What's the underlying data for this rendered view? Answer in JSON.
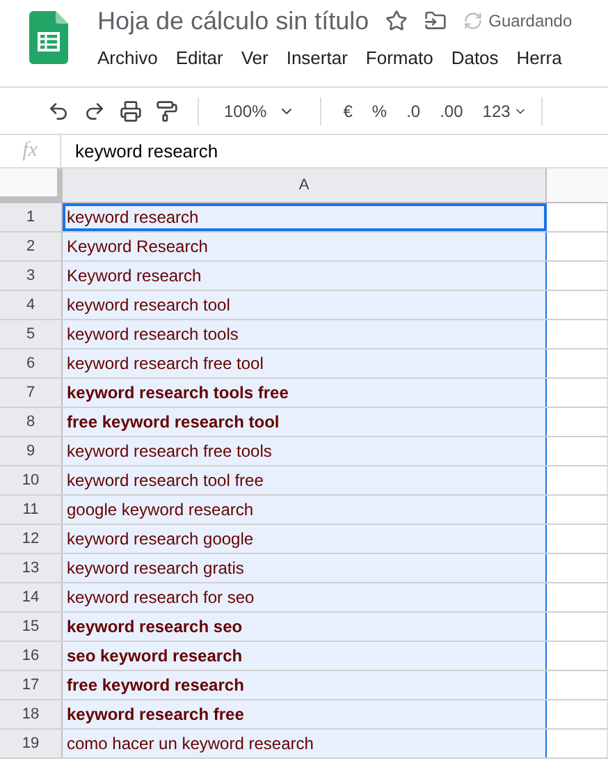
{
  "title": "Hoja de cálculo sin título",
  "save_status": "Guardando",
  "menu": [
    "Archivo",
    "Editar",
    "Ver",
    "Insertar",
    "Formato",
    "Datos",
    "Herra"
  ],
  "toolbar": {
    "zoom": "100%",
    "format_buttons": [
      "€",
      "%",
      ".0",
      ".00",
      "123"
    ]
  },
  "formula_bar": {
    "label": "fx",
    "value": "keyword research"
  },
  "column_headers": [
    "A"
  ],
  "rows": [
    {
      "number": "1",
      "text": "keyword research",
      "bold": false,
      "selected": true,
      "active": true
    },
    {
      "number": "2",
      "text": "Keyword Research",
      "bold": false,
      "selected": true,
      "active": false
    },
    {
      "number": "3",
      "text": "Keyword research",
      "bold": false,
      "selected": true,
      "active": false
    },
    {
      "number": "4",
      "text": "keyword research tool",
      "bold": false,
      "selected": true,
      "active": false
    },
    {
      "number": "5",
      "text": "keyword research tools",
      "bold": false,
      "selected": true,
      "active": false
    },
    {
      "number": "6",
      "text": "keyword research free tool",
      "bold": false,
      "selected": true,
      "active": false
    },
    {
      "number": "7",
      "text": "keyword research tools free",
      "bold": true,
      "selected": true,
      "active": false
    },
    {
      "number": "8",
      "text": "free keyword research tool",
      "bold": true,
      "selected": true,
      "active": false
    },
    {
      "number": "9",
      "text": "keyword research free tools",
      "bold": false,
      "selected": true,
      "active": false
    },
    {
      "number": "10",
      "text": "keyword research tool free",
      "bold": false,
      "selected": true,
      "active": false
    },
    {
      "number": "11",
      "text": "google keyword research",
      "bold": false,
      "selected": true,
      "active": false
    },
    {
      "number": "12",
      "text": "keyword research google",
      "bold": false,
      "selected": true,
      "active": false
    },
    {
      "number": "13",
      "text": "keyword research gratis",
      "bold": false,
      "selected": true,
      "active": false
    },
    {
      "number": "14",
      "text": "keyword research for seo",
      "bold": false,
      "selected": true,
      "active": false
    },
    {
      "number": "15",
      "text": "keyword research seo",
      "bold": true,
      "selected": true,
      "active": false
    },
    {
      "number": "16",
      "text": "seo keyword research",
      "bold": true,
      "selected": true,
      "active": false
    },
    {
      "number": "17",
      "text": "free keyword research",
      "bold": true,
      "selected": true,
      "active": false
    },
    {
      "number": "18",
      "text": "keyword research free",
      "bold": true,
      "selected": true,
      "active": false
    },
    {
      "number": "19",
      "text": "como hacer un keyword research",
      "bold": false,
      "selected": true,
      "active": false
    }
  ]
}
